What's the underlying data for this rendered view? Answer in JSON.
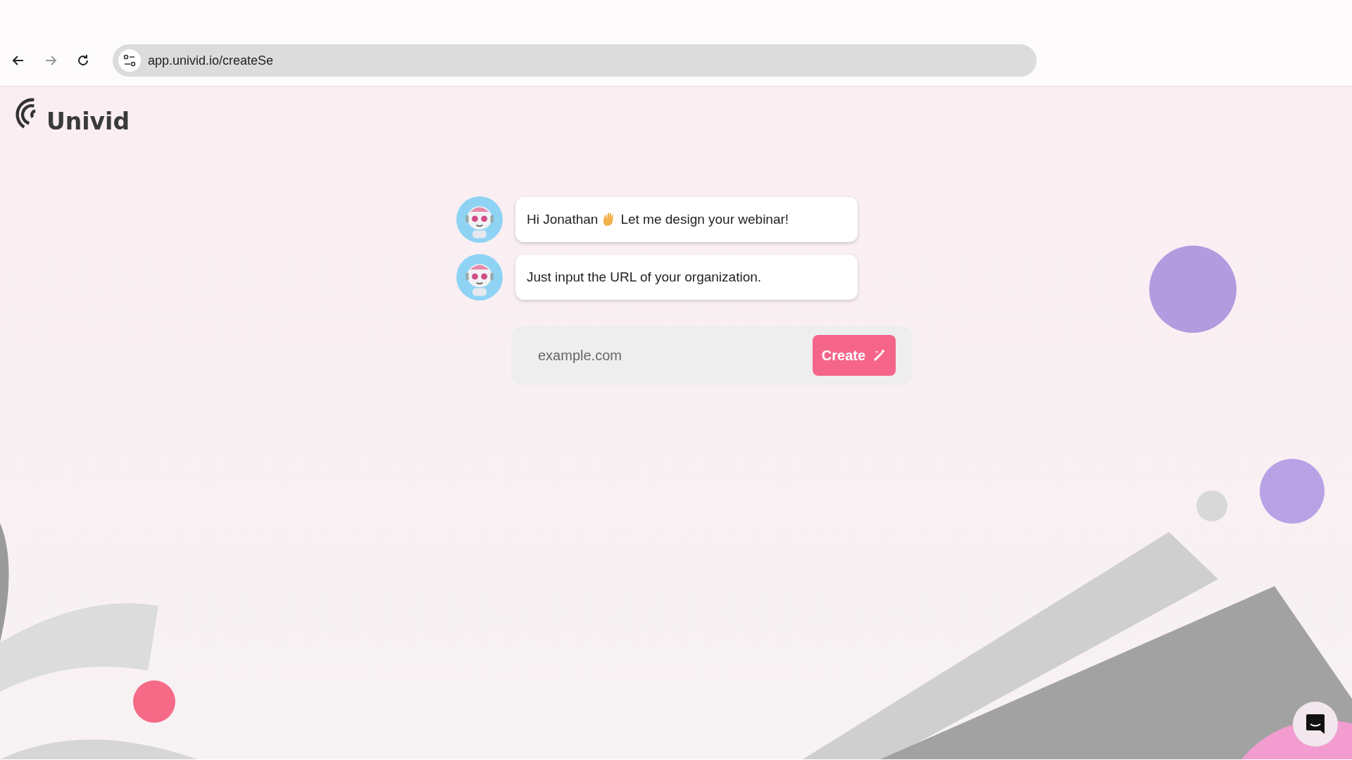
{
  "browser": {
    "url": "app.univid.io/createSe"
  },
  "logo": {
    "text": "Univid"
  },
  "messages": [
    {
      "text": "Hi Jonathan",
      "after_wave": "Let me design your webinar!"
    },
    {
      "text": "Just input the URL of your organization."
    }
  ],
  "url_form": {
    "placeholder": "example.com",
    "button": "Create"
  }
}
